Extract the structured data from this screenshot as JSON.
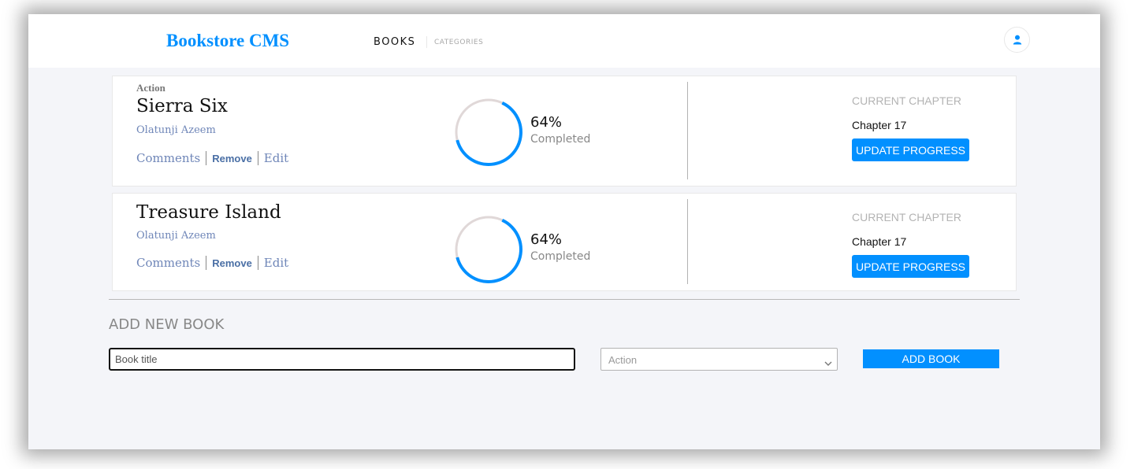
{
  "navbar": {
    "brand": "Bookstore CMS",
    "links": [
      "BOOKS",
      "CATEGORIES"
    ],
    "user_icon": "user-icon"
  },
  "books": [
    {
      "genre": "Action",
      "title": "Sierra Six",
      "author": "Olatunji Azeem",
      "actions": [
        "Comments",
        "Remove",
        "Edit"
      ],
      "percent_value": 64,
      "percent": "64%",
      "completed_label": "Completed",
      "current_chapter_label": "CURRENT CHAPTER",
      "current_chapter": "Chapter 17",
      "update_label": "UPDATE PROGRESS"
    },
    {
      "genre": "",
      "title": "Treasure Island",
      "author": "Olatunji Azeem",
      "actions": [
        "Comments",
        "Remove",
        "Edit"
      ],
      "percent_value": 64,
      "percent": "64%",
      "completed_label": "Completed",
      "current_chapter_label": "CURRENT CHAPTER",
      "current_chapter": "Chapter 17",
      "update_label": "UPDATE PROGRESS"
    }
  ],
  "add_form": {
    "heading": "ADD NEW BOOK",
    "title_placeholder": "Book title",
    "title_value": "",
    "category_selected": "Action",
    "submit_label": "ADD BOOK"
  },
  "colors": {
    "accent": "#0290ff",
    "progress_track": "#e0d8d8",
    "background": "#f4f5f9"
  }
}
